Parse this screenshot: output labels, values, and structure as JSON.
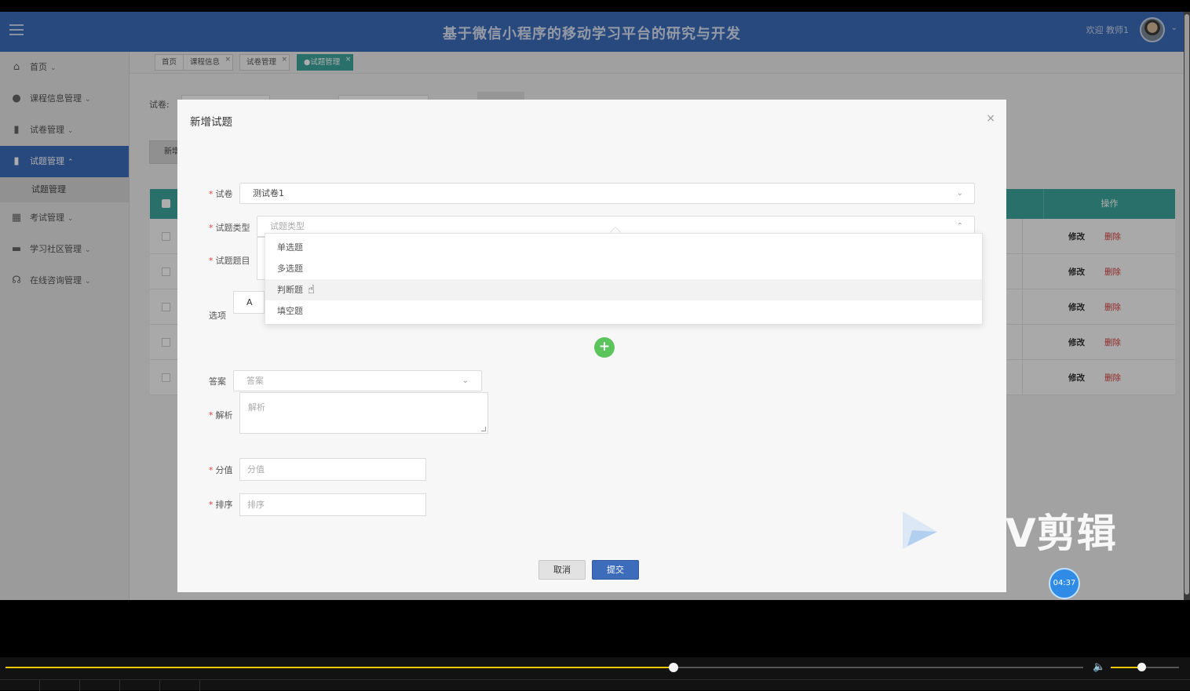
{
  "header": {
    "title": "基于微信小程序的移动学习平台的研究与开发",
    "welcome": "欢迎 教师1"
  },
  "sidebar": {
    "items": [
      {
        "label": "首页",
        "icon": "home-icon"
      },
      {
        "label": "课程信息管理",
        "icon": "record-icon"
      },
      {
        "label": "试卷管理",
        "icon": "book-icon"
      },
      {
        "label": "试题管理",
        "icon": "book-icon",
        "active": true
      },
      {
        "label": "考试管理",
        "icon": "grid-icon"
      },
      {
        "label": "学习社区管理",
        "icon": "archive-icon"
      },
      {
        "label": "在线咨询管理",
        "icon": "headset-icon"
      }
    ],
    "subitem": "试题管理"
  },
  "tabs": [
    {
      "label": "首页"
    },
    {
      "label": "课程信息"
    },
    {
      "label": "试卷管理"
    },
    {
      "label": "●试题管理",
      "active": true
    }
  ],
  "page": {
    "filter_label": "试卷:",
    "add_button": "新增",
    "op_header": "操作",
    "edit_label": "修改",
    "delete_label": "删除",
    "row_count": 5
  },
  "modal": {
    "title": "新增试题",
    "fields": {
      "paper_label": "试卷",
      "paper_value": "测试卷1",
      "type_label": "试题类型",
      "type_placeholder": "试题类型",
      "question_label": "试题题目",
      "options_label": "选项",
      "option_a": "A",
      "answer_label": "答案",
      "answer_placeholder": "答案",
      "analysis_label": "解析",
      "analysis_placeholder": "解析",
      "score_label": "分值",
      "score_placeholder": "分值",
      "order_label": "排序",
      "order_placeholder": "排序"
    },
    "type_options": [
      "单选题",
      "多选题",
      "判断题",
      "填空题"
    ],
    "hovered_option": "判断题",
    "cancel": "取消",
    "submit": "提交"
  },
  "watermark": "V剪辑",
  "timer": "04:37",
  "player": {
    "progress": 0.62,
    "volume": 0.45,
    "accent": "#f2c800"
  },
  "colors": {
    "header": "#3c6cba",
    "table_header": "#3fa59c",
    "delete": "#d63b3b"
  }
}
